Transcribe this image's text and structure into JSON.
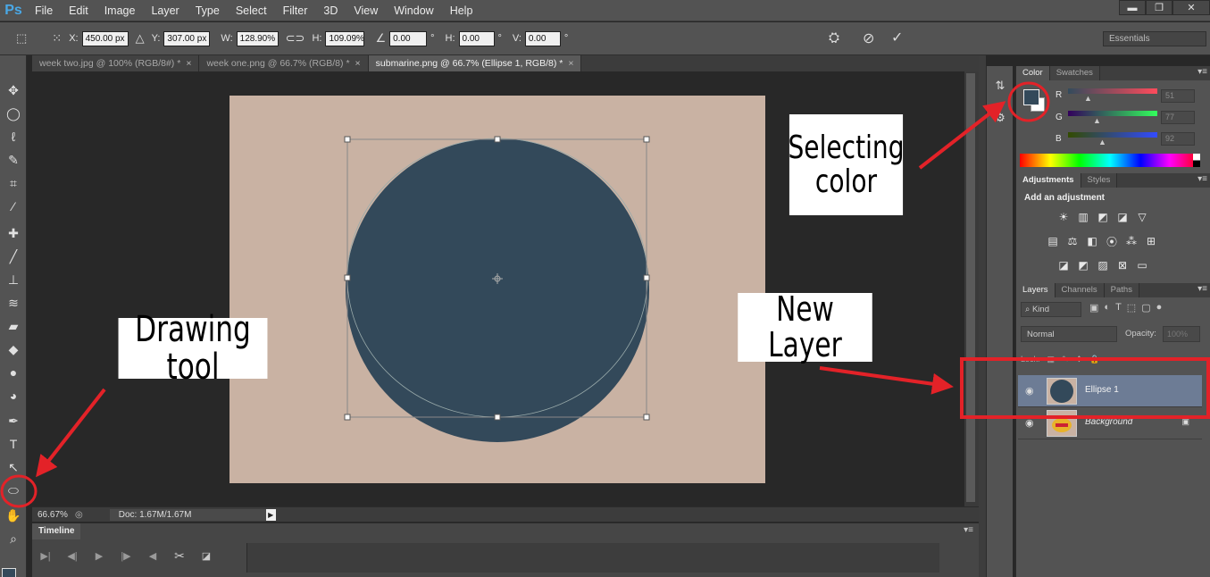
{
  "app": {
    "logo": "Ps"
  },
  "menu": [
    "File",
    "Edit",
    "Image",
    "Layer",
    "Type",
    "Select",
    "Filter",
    "3D",
    "View",
    "Window",
    "Help"
  ],
  "window_controls": {
    "minimize": "▬",
    "restore": "❐",
    "close": "✕"
  },
  "options": {
    "x_label": "X:",
    "x_value": "450.00 px",
    "y_label": "Y:",
    "y_value": "307.00 px",
    "w_label": "W:",
    "w_value": "128.90%",
    "h_label": "H:",
    "h_value": "109.09%",
    "angle_value": "0.00",
    "angle_unit": "°",
    "hskew_label": "H:",
    "hskew_value": "0.00",
    "hskew_unit": "°",
    "vskew_label": "V:",
    "vskew_value": "0.00",
    "vskew_unit": "°",
    "workspace": "Essentials"
  },
  "tabs": [
    {
      "label": "week two.jpg @ 100% (RGB/8#) *",
      "close": "×"
    },
    {
      "label": "week one.png @ 66.7% (RGB/8) *",
      "close": "×"
    },
    {
      "label": "submarine.png @ 66.7% (Ellipse 1, RGB/8) *",
      "close": "×"
    }
  ],
  "status": {
    "zoom": "66.67%",
    "doc": "Doc: 1.67M/1.67M",
    "arrow": "▶"
  },
  "timeline": {
    "title": "Timeline",
    "menu": "▾≡"
  },
  "color_panel": {
    "tabs": [
      "Color",
      "Swatches"
    ],
    "menu": "▾≡",
    "r_label": "R",
    "r_value": "51",
    "g_label": "G",
    "g_value": "77",
    "b_label": "B",
    "b_value": "92",
    "fg_color": "#33495a"
  },
  "adjustments_panel": {
    "tabs": [
      "Adjustments",
      "Styles"
    ],
    "menu": "▾≡",
    "title": "Add an adjustment"
  },
  "layers_panel": {
    "tabs": [
      "Layers",
      "Channels",
      "Paths"
    ],
    "menu": "▾≡",
    "filter": "⌕ Kind",
    "blend_mode": "Normal",
    "opacity_label": "Opacity:",
    "opacity_value": "100%",
    "lock_label": "Lock:",
    "layers": [
      {
        "name": "Ellipse 1",
        "selected": true
      },
      {
        "name": "Background",
        "locked": true
      }
    ]
  },
  "annotations": {
    "selecting_color": "Selecting color",
    "new_layer": "New Layer",
    "drawing_tool": "Drawing tool",
    "color": "#e32228"
  },
  "canvas": {
    "background": "#c9b2a3",
    "ellipse_color": "#33495a"
  }
}
